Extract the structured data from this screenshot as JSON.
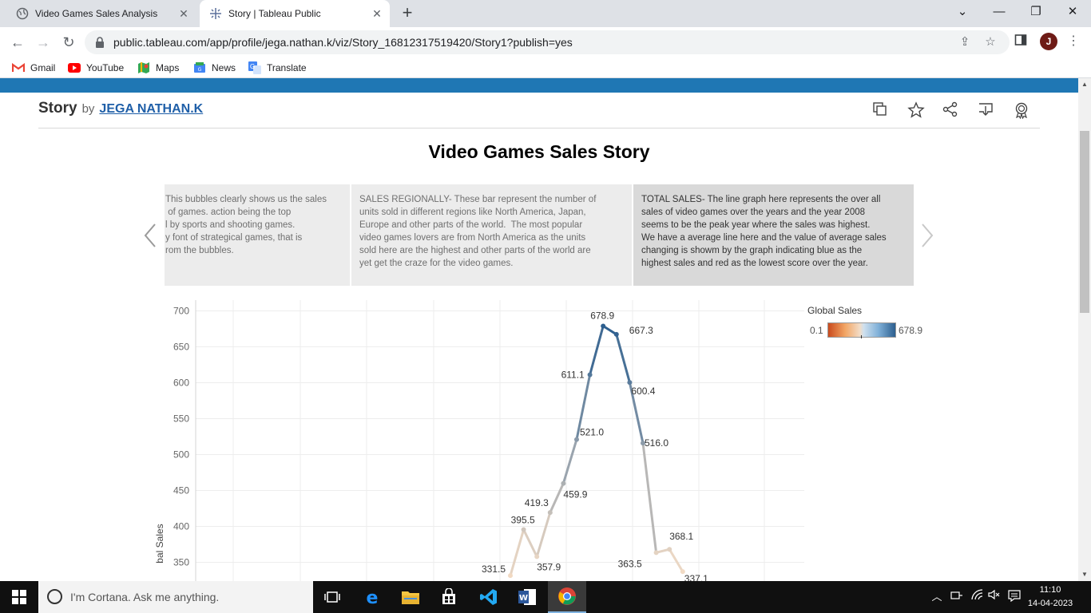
{
  "browser": {
    "tabs": [
      {
        "title": "Video Games Sales Analysis",
        "active": false
      },
      {
        "title": "Story | Tableau Public",
        "active": true
      }
    ],
    "url": "public.tableau.com/app/profile/jega.nathan.k/viz/Story_16812317519420/Story1?publish=yes",
    "profile_initial": "J",
    "bookmarks": [
      "Gmail",
      "YouTube",
      "Maps",
      "News",
      "Translate"
    ]
  },
  "story": {
    "heading": "Story",
    "by": "by",
    "author": "JEGA NATHAN.K",
    "viz_title": "Video Games Sales Story",
    "captions": [
      {
        "text": "This bubbles clearly shows us the sales of games. action being the top l by sports and shooting games. y font of strategical games, that is rom the bubbles.",
        "lines": [
          "This bubbles clearly shows us the sales",
          " of games. action being the top",
          "l by sports and shooting games.",
          "y font of strategical games, that is",
          "rom the bubbles."
        ]
      },
      {
        "text": "SALES REGIONALLY- These bar represent the number of units sold in different regions like North America, Japan, Europe and other parts of the world.  The most popular video games lovers are from North America as the units sold here are the highest and other parts of the world are yet get the craze for the video games.",
        "lines": [
          "SALES REGIONALLY- These bar represent the number of",
          "units sold in different regions like North America, Japan,",
          "Europe and other parts of the world.  The most popular",
          "video games lovers are from North America as the units",
          "sold here are the highest and other parts of the world are",
          "yet get the craze for the video games."
        ]
      },
      {
        "text": "TOTAL SALES- The line graph here represents the over all sales of video games over the years and the year 2008 seems to be the peak year where the sales was highest. We have a average line here and the value of average sales changing is showm by the graph indicating blue as the highest sales and red as the lowest score over the year.",
        "lines": [
          "TOTAL SALES- The line graph here represents the over all",
          "sales of video games over the years and the year 2008",
          "seems to be the peak year where the sales was highest.",
          "We have a average line here and the value of average sales",
          "changing is showm by the graph indicating blue as the",
          "highest sales and red as the lowest score over the year."
        ]
      }
    ]
  },
  "chart_data": {
    "type": "line",
    "title": "",
    "ylabel": "Global Sales",
    "ylabel_visible": "bal Sales",
    "ylim": [
      345,
      710
    ],
    "yticks": [
      "700",
      "650",
      "600",
      "550",
      "500",
      "450",
      "400",
      "350"
    ],
    "ytick_values": [
      700,
      650,
      600,
      550,
      500,
      450,
      400,
      350
    ],
    "grid": true,
    "series": [
      {
        "name": "Global Sales",
        "points": [
          {
            "i": 0,
            "y": 331.5,
            "label": "331.5"
          },
          {
            "i": 1,
            "y": 395.5,
            "label": "395.5"
          },
          {
            "i": 2,
            "y": 357.9,
            "label": "357.9"
          },
          {
            "i": 3,
            "y": 419.3,
            "label": "419.3"
          },
          {
            "i": 4,
            "y": 459.9,
            "label": "459.9"
          },
          {
            "i": 5,
            "y": 521.0,
            "label": "521.0"
          },
          {
            "i": 6,
            "y": 611.1,
            "label": "611.1"
          },
          {
            "i": 7,
            "y": 678.9,
            "label": "678.9"
          },
          {
            "i": 8,
            "y": 667.3,
            "label": "667.3"
          },
          {
            "i": 9,
            "y": 600.4,
            "label": "600.4"
          },
          {
            "i": 10,
            "y": 516.0,
            "label": "516.0"
          },
          {
            "i": 11,
            "y": 363.5,
            "label": "363.5"
          },
          {
            "i": 12,
            "y": 368.1,
            "label": "368.1"
          },
          {
            "i": 13,
            "y": 337.1,
            "label": "337.1"
          }
        ]
      }
    ],
    "legend": {
      "title": "Global Sales",
      "min": "0.1",
      "max": "678.9",
      "placement": "top-right"
    },
    "colors": {
      "low": "#c94b1d",
      "mid": "#f2dcc6",
      "high": "#2d5f8f"
    }
  },
  "taskbar": {
    "search_placeholder": "I'm Cortana. Ask me anything.",
    "time": "11:10",
    "date": "14-04-2023"
  },
  "colors": {
    "tableau_blue": "#1f77b4",
    "author_link": "#1f5fa8"
  }
}
